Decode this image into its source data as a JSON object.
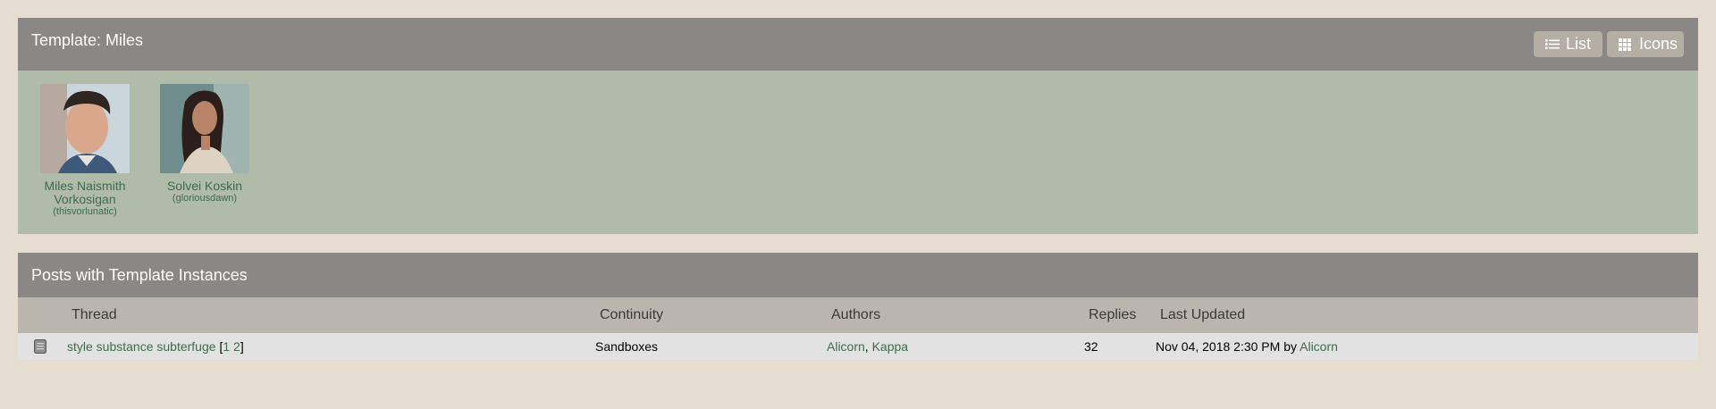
{
  "template_panel": {
    "title": "Template: Miles",
    "buttons": {
      "list": "List",
      "icons": "Icons"
    },
    "characters": [
      {
        "name": "Miles Naismith Vorkosigan",
        "handle": "(thisvorlunatic)"
      },
      {
        "name": "Solvei Koskin",
        "handle": "(gloriousdawn)"
      }
    ]
  },
  "posts_panel": {
    "title": "Posts with Template Instances",
    "columns": {
      "thread": "Thread",
      "continuity": "Continuity",
      "authors": "Authors",
      "replies": "Replies",
      "last_updated": "Last Updated"
    },
    "rows": [
      {
        "thread": "style substance subterfuge",
        "pages_open": "[",
        "page_1": "1",
        "page_2": "2",
        "pages_close": "]",
        "continuity": "Sandboxes",
        "author_1": "Alicorn",
        "author_sep": ",",
        "author_2": "Kappa",
        "replies": "32",
        "updated_time": "Nov 04, 2018 2:30 PM",
        "updated_by_word": "by",
        "updated_by": "Alicorn"
      }
    ]
  },
  "colors": {
    "page_bg": "#e4ddd0",
    "header_bg": "#8c8787",
    "panel_bg": "#b0bbaa",
    "link": "#3f6b4e",
    "row_bg": "#e2e2e2"
  }
}
